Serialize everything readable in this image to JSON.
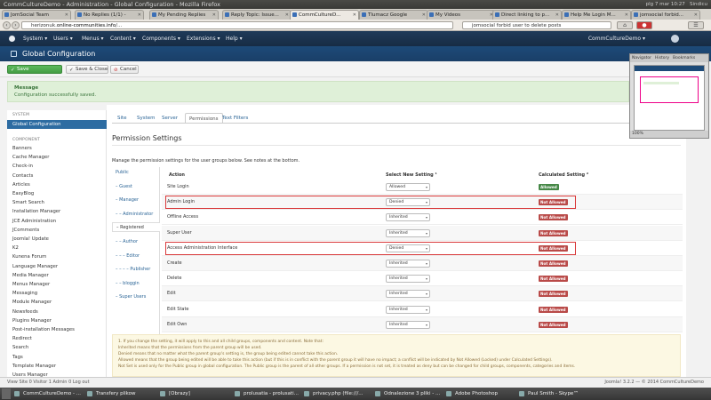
{
  "window_title": "CommCultureDemo - Administration - Global Configuration - Mozilla Firefox",
  "os_status": "plg 7 mar 10:27",
  "os_user": "Sindicu",
  "browser_tabs": [
    {
      "label": "JomSocial Team"
    },
    {
      "label": "No Replies (1/1) -"
    },
    {
      "label": "My Pending Replies"
    },
    {
      "label": "Reply Topic: Issue..."
    },
    {
      "label": "CommCultureD...",
      "active": true
    },
    {
      "label": "Tlumacz Google"
    },
    {
      "label": "My Videos"
    },
    {
      "label": "Direct linking to p..."
    },
    {
      "label": "Help Me Login M..."
    },
    {
      "label": "jomsocial forbid..."
    }
  ],
  "address": {
    "prefix": "herizonuk.",
    "domain": "online-communities.info",
    "rest": "/..."
  },
  "search": {
    "value": "jomsocial forbid user to delete posts"
  },
  "joomla_nav": {
    "items": [
      "System ▾",
      "Users ▾",
      "Menus ▾",
      "Content ▾",
      "Components ▾",
      "Extensions ▾",
      "Help ▾"
    ],
    "site": "CommCultureDemo ▾"
  },
  "header": {
    "title": "Global Configuration",
    "brand": "Joomla!"
  },
  "toolbar": {
    "save": "Save",
    "save_close": "Save & Close",
    "cancel": "Cancel"
  },
  "message": {
    "heading": "Message",
    "text": "Configuration successfully saved."
  },
  "navigator": {
    "tabs": [
      "Navigator",
      "History",
      "Bookmarks"
    ],
    "zoom": "100%"
  },
  "sidebar": {
    "system_heading": "SYSTEM",
    "system_item": "Global Configuration",
    "component_heading": "COMPONENT",
    "components": [
      "Banners",
      "Cache Manager",
      "Check-in",
      "Contacts",
      "Articles",
      "EasyBlog",
      "Smart Search",
      "Installation Manager",
      "JCE Administration",
      "JComments",
      "Joomla! Update",
      "K2",
      "Kunena Forum",
      "Language Manager",
      "Media Manager",
      "Menus Manager",
      "Messaging",
      "Module Manager",
      "Newsfeeds",
      "Plugins Manager",
      "Post-installation Messages",
      "Redirect",
      "Search",
      "Tags",
      "Template Manager",
      "Users Manager"
    ]
  },
  "tabs": [
    "Site",
    "System",
    "Server",
    "Permissions",
    "Text Filters"
  ],
  "active_tab": "Permissions",
  "page_title": "Permission Settings",
  "description": "Manage the permission settings for the user groups below. See notes at the bottom.",
  "groups": [
    "Public",
    "– Guest",
    "– Manager",
    "– – Administrator",
    "– Registered",
    "– – Author",
    "– – – Editor",
    "– – – – Publisher",
    "– – bloggin",
    "– Super Users"
  ],
  "selected_group": "– Registered",
  "columns": {
    "action": "Action",
    "setting": "Select New Setting ¹",
    "calculated": "Calculated Setting ²"
  },
  "rows": [
    {
      "action": "Site Login",
      "setting": "Allowed",
      "calc": "Allowed"
    },
    {
      "action": "Admin Login",
      "setting": "Denied",
      "calc": "Not Allowed"
    },
    {
      "action": "Offline Access",
      "setting": "Inherited",
      "calc": "Not Allowed"
    },
    {
      "action": "Super User",
      "setting": "Inherited",
      "calc": "Not Allowed"
    },
    {
      "action": "Access Administration Interface",
      "setting": "Denied",
      "calc": "Not Allowed"
    },
    {
      "action": "Create",
      "setting": "Inherited",
      "calc": "Not Allowed"
    },
    {
      "action": "Delete",
      "setting": "Inherited",
      "calc": "Not Allowed"
    },
    {
      "action": "Edit",
      "setting": "Inherited",
      "calc": "Not Allowed"
    },
    {
      "action": "Edit State",
      "setting": "Inherited",
      "calc": "Not Allowed"
    },
    {
      "action": "Edit Own",
      "setting": "Inherited",
      "calc": "Not Allowed"
    }
  ],
  "notes": [
    "1. If you change the setting, it will apply to this and all child groups, components and content. Note that:",
    "Inherited means that the permissions from the parent group will be used.",
    "Denied means that no matter what the parent group's setting is, the group being edited cannot take this action.",
    "Allowed means that the group being edited will be able to take this action (but if this is in conflict with the parent group it will have no impact; a conflict will be indicated by Not Allowed (Locked) under Calculated Settings).",
    "Not Set is used only for the Public group in global configuration. The Public group is the parent of all other groups. If a permission is not set, it is treated as deny but can be changed for child groups, components, categories and items."
  ],
  "status_bar": {
    "left": "View Site  0 Visitor  1 Admin  0  Log out",
    "right": "Joomla! 3.2.2 — © 2014 CommCultureDemo"
  },
  "taskbar": [
    "CommCultureDemo - ...",
    "Transfery plikow",
    "[Obrazy]",
    "prolusatia - prolusati...",
    "privacy.php (file:///...",
    "Odnalezione 3 pliki - ...",
    "Adobe Photoshop",
    "Paul Smith - Skype™"
  ],
  "colors": {
    "joomla_nav": "#1f3a59",
    "header": "#1d4a78",
    "success": "#dff0d8",
    "danger": "#b94a48",
    "allowed": "#468847",
    "highlight": "#d9393a"
  }
}
